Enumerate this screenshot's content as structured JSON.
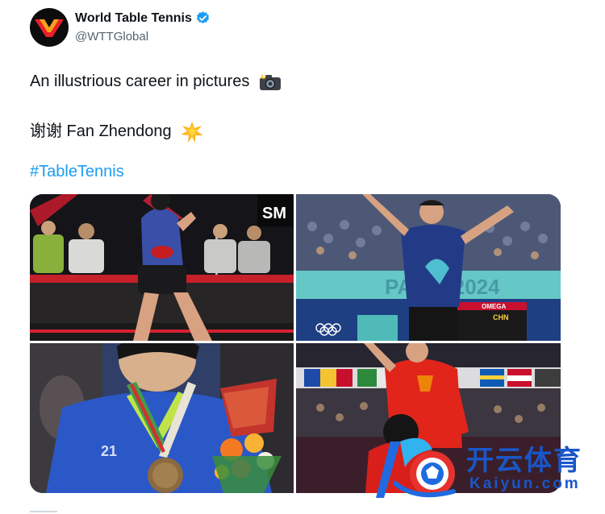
{
  "account": {
    "name": "World Table Tennis",
    "handle": "@WTTGlobal",
    "verified_icon": "verified-badge-icon",
    "avatar_icon": "wtt-logo-icon"
  },
  "tweet": {
    "line1": "An illustrious career in pictures",
    "line1_emoji": "camera-flash-icon",
    "line2": "谢谢 Fan Zhendong",
    "line2_emoji": "star-burst-icon",
    "hashtag": "#TableTennis"
  },
  "photos": [
    {
      "name": "celebrating-match-point",
      "background": "#1a1a1e"
    },
    {
      "name": "arms-wide-olympics",
      "background": "#1f2f4a",
      "scoreboard": "CHN"
    },
    {
      "name": "medal-ceremony-flowers",
      "background": "#2a3f6e"
    },
    {
      "name": "red-shirt-celebration",
      "background": "#2b2b34"
    }
  ],
  "watermark": {
    "cn": "开云体育",
    "en": "Kaiyun.com",
    "color": "#1a56c7"
  },
  "colors": {
    "link": "#1d9bf0",
    "verified": "#1d9bf0",
    "handle": "#536471"
  }
}
